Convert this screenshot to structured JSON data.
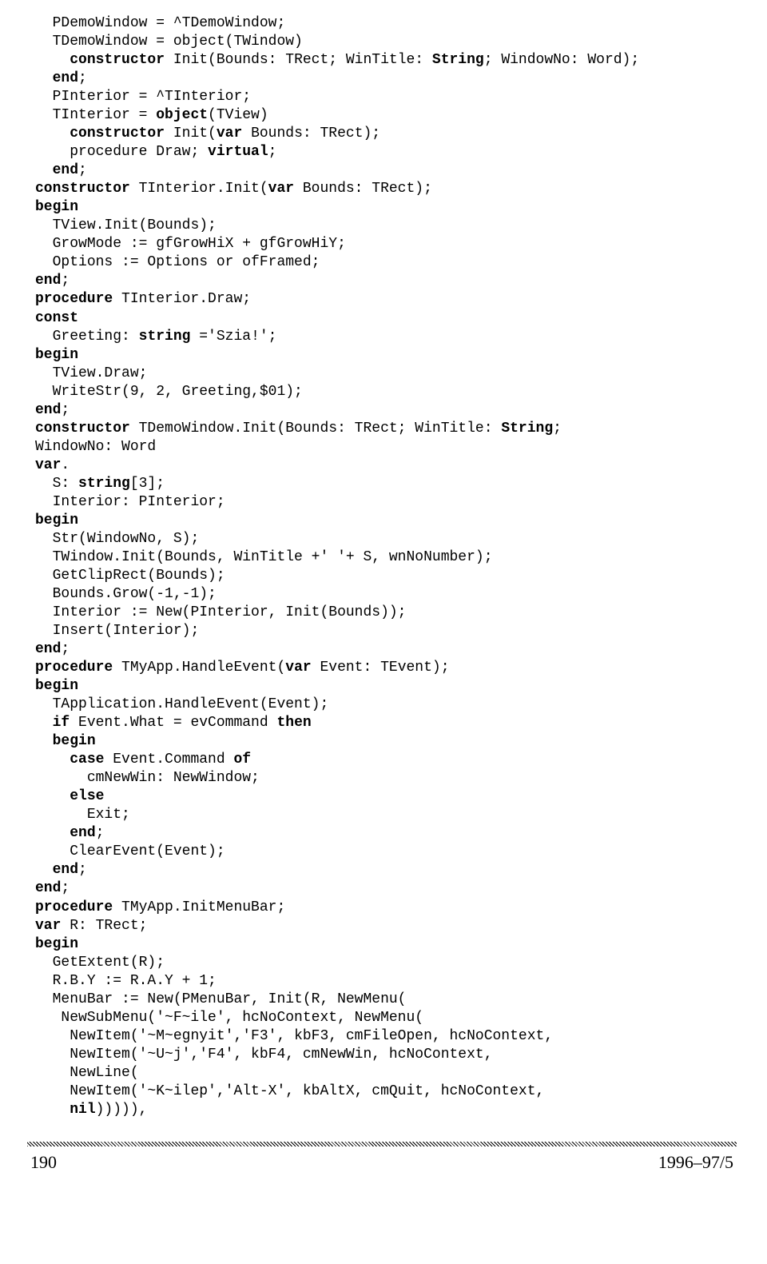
{
  "code_lines": [
    [
      {
        "t": "  PDemoWindow = ^TDemoWindow;"
      }
    ],
    [
      {
        "t": "  TDemoWindow = object(TWindow)"
      }
    ],
    [
      {
        "t": "    "
      },
      {
        "t": "constructor",
        "b": true
      },
      {
        "t": " Init(Bounds: TRect; WinTitle: "
      },
      {
        "t": "String",
        "b": true
      },
      {
        "t": "; WindowNo: Word);"
      }
    ],
    [
      {
        "t": "  "
      },
      {
        "t": "end",
        "b": true
      },
      {
        "t": ";"
      }
    ],
    [
      {
        "t": "  PInterior = ^TInterior;"
      }
    ],
    [
      {
        "t": "  TInterior = "
      },
      {
        "t": "object",
        "b": true
      },
      {
        "t": "(TView)"
      }
    ],
    [
      {
        "t": "    "
      },
      {
        "t": "constructor",
        "b": true
      },
      {
        "t": " Init("
      },
      {
        "t": "var",
        "b": true
      },
      {
        "t": " Bounds: TRect);"
      }
    ],
    [
      {
        "t": "    procedure Draw; "
      },
      {
        "t": "virtual",
        "b": true
      },
      {
        "t": ";"
      }
    ],
    [
      {
        "t": "  "
      },
      {
        "t": "end",
        "b": true
      },
      {
        "t": ";"
      }
    ],
    [
      {
        "t": "constructor",
        "b": true
      },
      {
        "t": " TInterior.Init("
      },
      {
        "t": "var",
        "b": true
      },
      {
        "t": " Bounds: TRect);"
      }
    ],
    [
      {
        "t": "begin",
        "b": true
      }
    ],
    [
      {
        "t": "  TView.Init(Bounds);"
      }
    ],
    [
      {
        "t": "  GrowMode := gfGrowHiX + gfGrowHiY;"
      }
    ],
    [
      {
        "t": "  Options := Options or ofFramed;"
      }
    ],
    [
      {
        "t": "end",
        "b": true
      },
      {
        "t": ";"
      }
    ],
    [
      {
        "t": "procedure",
        "b": true
      },
      {
        "t": " TInterior.Draw;"
      }
    ],
    [
      {
        "t": "const",
        "b": true
      }
    ],
    [
      {
        "t": "  Greeting: "
      },
      {
        "t": "string",
        "b": true
      },
      {
        "t": " ='Szia!';"
      }
    ],
    [
      {
        "t": "begin",
        "b": true
      }
    ],
    [
      {
        "t": "  TView.Draw;"
      }
    ],
    [
      {
        "t": "  WriteStr(9, 2, Greeting,$01);"
      }
    ],
    [
      {
        "t": "end",
        "b": true
      },
      {
        "t": ";"
      }
    ],
    [
      {
        "t": "constructor",
        "b": true
      },
      {
        "t": " TDemoWindow.Init(Bounds: TRect; WinTitle: "
      },
      {
        "t": "String",
        "b": true
      },
      {
        "t": ";"
      }
    ],
    [
      {
        "t": "WindowNo: Word"
      }
    ],
    [
      {
        "t": "var",
        "b": true
      },
      {
        "t": "."
      }
    ],
    [
      {
        "t": "  S: "
      },
      {
        "t": "string",
        "b": true
      },
      {
        "t": "[3];"
      }
    ],
    [
      {
        "t": "  Interior: PInterior;"
      }
    ],
    [
      {
        "t": "begin",
        "b": true
      }
    ],
    [
      {
        "t": "  Str(WindowNo, S);"
      }
    ],
    [
      {
        "t": "  TWindow.Init(Bounds, WinTitle +' '+ S, wnNoNumber);"
      }
    ],
    [
      {
        "t": "  GetClipRect(Bounds);"
      }
    ],
    [
      {
        "t": "  Bounds.Grow(-1,-1);"
      }
    ],
    [
      {
        "t": "  Interior := New(PInterior, Init(Bounds));"
      }
    ],
    [
      {
        "t": "  Insert(Interior);"
      }
    ],
    [
      {
        "t": "end",
        "b": true
      },
      {
        "t": ";"
      }
    ],
    [
      {
        "t": "procedure",
        "b": true
      },
      {
        "t": " TMyApp.HandleEvent("
      },
      {
        "t": "var",
        "b": true
      },
      {
        "t": " Event: TEvent);"
      }
    ],
    [
      {
        "t": "begin",
        "b": true
      }
    ],
    [
      {
        "t": "  TApplication.HandleEvent(Event);"
      }
    ],
    [
      {
        "t": "  "
      },
      {
        "t": "if",
        "b": true
      },
      {
        "t": " Event.What = evCommand "
      },
      {
        "t": "then",
        "b": true
      }
    ],
    [
      {
        "t": "  "
      },
      {
        "t": "begin",
        "b": true
      }
    ],
    [
      {
        "t": "    "
      },
      {
        "t": "case",
        "b": true
      },
      {
        "t": " Event.Command "
      },
      {
        "t": "of",
        "b": true
      }
    ],
    [
      {
        "t": "      cmNewWin: NewWindow;"
      }
    ],
    [
      {
        "t": "    "
      },
      {
        "t": "else",
        "b": true
      }
    ],
    [
      {
        "t": "      Exit;"
      }
    ],
    [
      {
        "t": "    "
      },
      {
        "t": "end",
        "b": true
      },
      {
        "t": ";"
      }
    ],
    [
      {
        "t": "    ClearEvent(Event);"
      }
    ],
    [
      {
        "t": "  "
      },
      {
        "t": "end",
        "b": true
      },
      {
        "t": ";"
      }
    ],
    [
      {
        "t": "end",
        "b": true
      },
      {
        "t": ";"
      }
    ],
    [
      {
        "t": "procedure",
        "b": true
      },
      {
        "t": " TMyApp.InitMenuBar;"
      }
    ],
    [
      {
        "t": "var",
        "b": true
      },
      {
        "t": " R: TRect;"
      }
    ],
    [
      {
        "t": "begin",
        "b": true
      }
    ],
    [
      {
        "t": "  GetExtent(R);"
      }
    ],
    [
      {
        "t": "  R.B.Y := R.A.Y + 1;"
      }
    ],
    [
      {
        "t": "  MenuBar := New(PMenuBar, Init(R, NewMenu("
      }
    ],
    [
      {
        "t": "   NewSubMenu('~F~ile', hcNoContext, NewMenu("
      }
    ],
    [
      {
        "t": "    NewItem('~M~egnyit','F3', kbF3, cmFileOpen, hcNoContext,"
      }
    ],
    [
      {
        "t": "    NewItem('~U~j','F4', kbF4, cmNewWin, hcNoContext,"
      }
    ],
    [
      {
        "t": "    NewLine("
      }
    ],
    [
      {
        "t": "    NewItem('~K~ilep','Alt-X', kbAltX, cmQuit, hcNoContext,"
      }
    ],
    [
      {
        "t": "    "
      },
      {
        "t": "nil",
        "b": true
      },
      {
        "t": "))))),"
      }
    ]
  ],
  "footer": {
    "page": "190",
    "issue": "1996–97/5"
  }
}
